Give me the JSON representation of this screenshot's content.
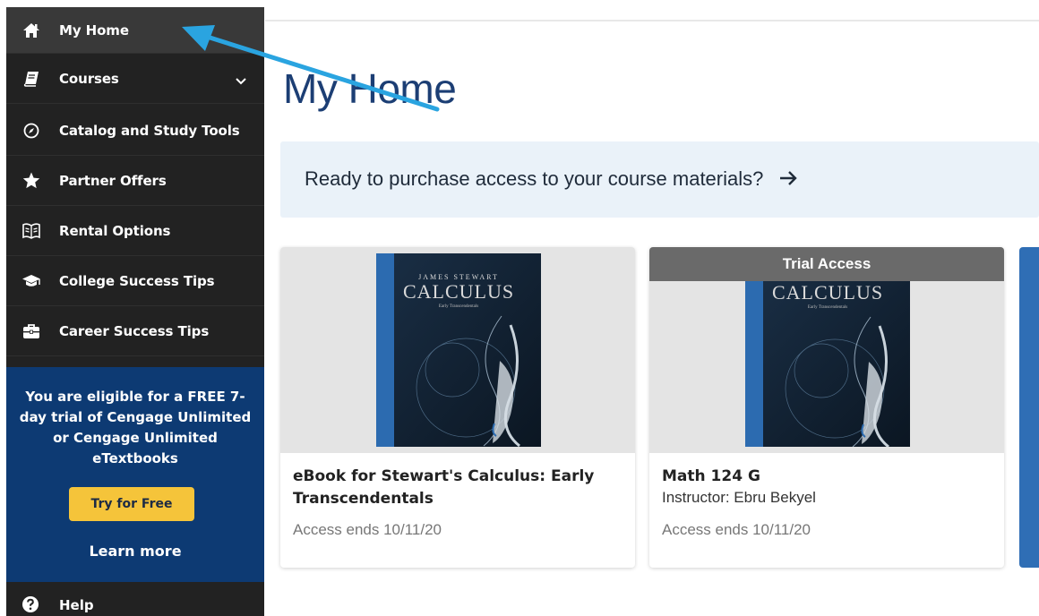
{
  "sidebar": {
    "items": [
      {
        "label": "My Home",
        "icon": "home-icon"
      },
      {
        "label": "Courses",
        "icon": "book-icon"
      },
      {
        "label": "Catalog and Study Tools",
        "icon": "compass-icon"
      },
      {
        "label": "Partner Offers",
        "icon": "star-icon"
      },
      {
        "label": "Rental Options",
        "icon": "open-book-icon"
      },
      {
        "label": "College Success Tips",
        "icon": "graduation-cap-icon"
      },
      {
        "label": "Career Success Tips",
        "icon": "briefcase-icon"
      }
    ],
    "promo": {
      "text": "You are eligible for a FREE 7-day trial of Cengage Unlimited or Cengage Unlimited eTextbooks",
      "button": "Try for Free",
      "link": "Learn more"
    },
    "help": {
      "label": "Help",
      "icon": "question-circle-icon"
    }
  },
  "main": {
    "title": "My Home",
    "banner": {
      "text": "Ready to purchase access to your course materials?",
      "icon": "arrow-right-icon"
    },
    "cards": [
      {
        "title": "eBook for Stewart's Calculus: Early Transcendentals",
        "access": "Access ends 10/11/20",
        "cover": {
          "author": "JAMES STEWART",
          "title": "CALCULUS",
          "subtitle": "Early Transcendentals"
        }
      },
      {
        "badge": "Trial Access",
        "title": "Math 124 G",
        "instructor": "Instructor: Ebru Bekyel",
        "access": "Access ends 10/11/20",
        "cover": {
          "title": "CALCULUS",
          "subtitle": "Early Transcendentals"
        }
      }
    ]
  },
  "colors": {
    "sidebar": "#222222",
    "promo": "#0d3a73",
    "try_button": "#f5c43a",
    "title": "#1c3e74",
    "banner": "#eaf2f9",
    "annotation_arrow": "#2aa4e0"
  }
}
